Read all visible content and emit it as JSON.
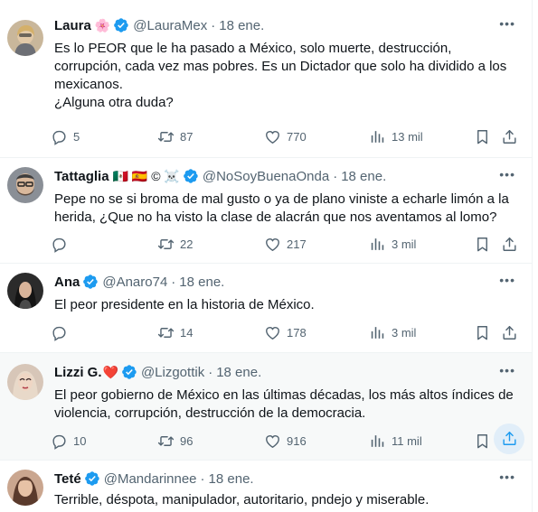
{
  "tweets": [
    {
      "name": "Laura",
      "emoji": "🌸",
      "handle": "@LauraMex",
      "date": "18 ene.",
      "lines": [
        "Es lo PEOR que le ha pasado a México, solo muerte, destrucción, corrupción, cada vez mas pobres. Es un Dictador que solo ha dividido a los mexicanos.",
        "¿Alguna otra duda?"
      ],
      "replies": "5",
      "retweets": "87",
      "likes": "770",
      "views": "13 mil"
    },
    {
      "name": "Tattaglia",
      "emoji": "🇲🇽 🇪🇸 © ☠️",
      "handle": "@NoSoyBuenaOnda",
      "date": "18 ene.",
      "lines": [
        "Pepe no se si broma de mal gusto o ya de plano viniste a echarle limón a la herida, ¿Que no ha visto la clase de alacrán que nos aventamos al lomo?"
      ],
      "replies": "",
      "retweets": "22",
      "likes": "217",
      "views": "3 mil"
    },
    {
      "name": "Ana",
      "emoji": "",
      "handle": "@Anaro74",
      "date": "18 ene.",
      "lines": [
        "El peor presidente en la historia de México."
      ],
      "replies": "",
      "retweets": "14",
      "likes": "178",
      "views": "3 mil"
    },
    {
      "name": "Lizzi G.",
      "emoji": "❤️",
      "handle": "@Lizgottik",
      "date": "18 ene.",
      "lines": [
        "El peor gobierno de México en las últimas décadas, los más altos índices de violencia, corrupción, destrucción de la democracia."
      ],
      "replies": "10",
      "retweets": "96",
      "likes": "916",
      "views": "11 mil"
    },
    {
      "name": "Teté",
      "emoji": "",
      "handle": "@Mandarinnee",
      "date": "18 ene.",
      "lines": [
        "Terrible, déspota, manipulador, autoritario, pndejo y miserable."
      ]
    }
  ],
  "colors": {
    "verified": "#1d9bf0",
    "text": "#0f1419",
    "muted": "#536471",
    "highlight": "#f7f9f9",
    "share_hover": "#1d9bf0"
  },
  "icons": {
    "reply": "reply-icon",
    "retweet": "retweet-icon",
    "like": "heart-icon",
    "views": "views-icon",
    "bookmark": "bookmark-icon",
    "share": "share-icon",
    "more": "more-icon",
    "verified": "verified-badge-icon"
  }
}
